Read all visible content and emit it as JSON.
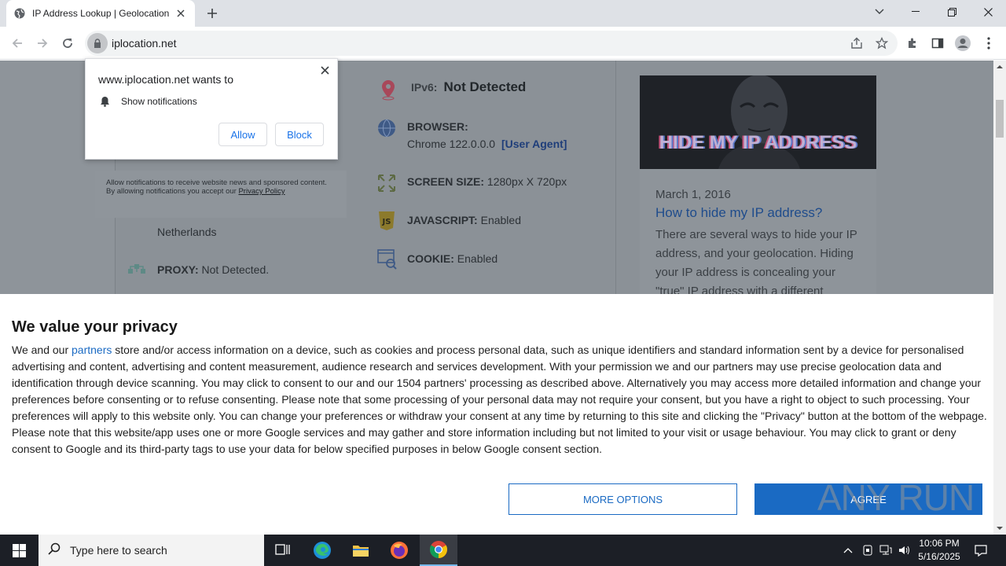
{
  "browser": {
    "tab_title": "IP Address Lookup | Geolocation",
    "url": "iplocation.net"
  },
  "notification_prompt": {
    "heading": "www.iplocation.net wants to",
    "permission": "Show notifications",
    "allow_label": "Allow",
    "block_label": "Block"
  },
  "page": {
    "notice_text": "Allow notifications to receive website news and sponsored content. By allowing notifications you accept our",
    "notice_link": "Privacy Policy",
    "country_value": "Netherlands",
    "proxy_label": "PROXY:",
    "proxy_value": "Not Detected.",
    "ipv6_label": "IPv6:",
    "ipv6_value": "Not Detected",
    "browser_label": "BROWSER:",
    "browser_value": "Chrome 122.0.0.0",
    "user_agent_link": "[User Agent]",
    "screen_label": "SCREEN SIZE:",
    "screen_value": "1280px X 720px",
    "javascript_label": "JAVASCRIPT:",
    "javascript_value": "Enabled",
    "cookie_label": "COOKIE:",
    "cookie_value": "Enabled",
    "article": {
      "image_title": "HIDE MY IP ADDRESS",
      "date": "March 1, 2016",
      "title": "How to hide my IP address?",
      "excerpt": "There are several ways to hide your IP address, and your geolocation. Hiding your IP address is concealing your \"true\" IP address with a different"
    }
  },
  "consent": {
    "heading": "We value your privacy",
    "text_before_link": "We and our ",
    "partners_link": "partners",
    "text_after_link": " store and/or access information on a device, such as cookies and process personal data, such as unique identifiers and standard information sent by a device for personalised advertising and content, advertising and content measurement, audience research and services development. With your permission we and our partners may use precise geolocation data and identification through device scanning. You may click to consent to our and our 1504 partners' processing as described above. Alternatively you may access more detailed information and change your preferences before consenting or to refuse consenting. Please note that some processing of your personal data may not require your consent, but you have a right to object to such processing. Your preferences will apply to this website only. You can change your preferences or withdraw your consent at any time by returning to this site and clicking the \"Privacy\" button at the bottom of the webpage.",
    "google_text": "Please note that this website/app uses one or more Google services and may gather and store information including but not limited to your visit or usage behaviour. You may click to grant or deny consent to Google and its third-party tags to use your data for below specified purposes in below Google consent section.",
    "more_options_label": "MORE OPTIONS",
    "agree_label": "AGREE"
  },
  "watermark": "ANY RUN",
  "taskbar": {
    "search_placeholder": "Type here to search",
    "time": "10:06 PM",
    "date": "5/16/2025"
  },
  "colors": {
    "accent": "#1a6ac3",
    "chrome_blue": "#1a73e8",
    "taskbar": "#1c1f26"
  }
}
